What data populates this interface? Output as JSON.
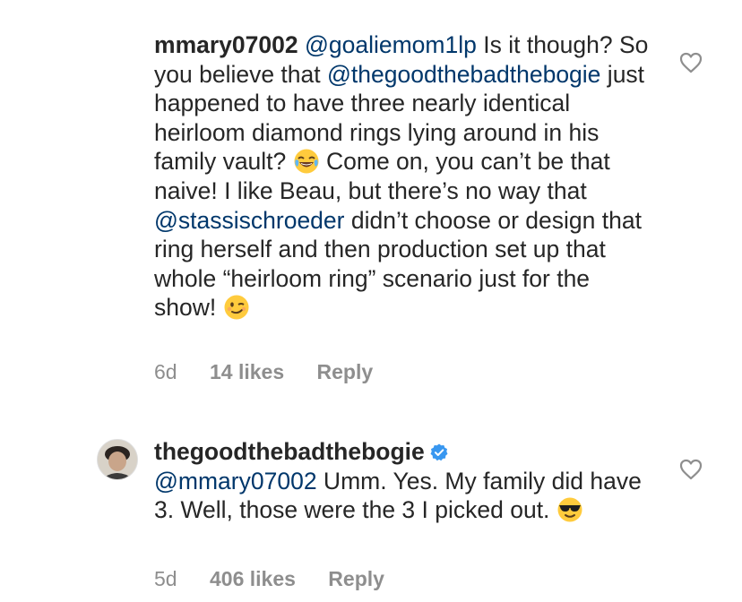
{
  "comments": [
    {
      "username": "mmary07002",
      "mention": "@goaliemom1lp",
      "text_1": " Is it though? So you believe that ",
      "mention_2": "@thegoodthebadthebogie",
      "text_2": " just happened to have three nearly identical heirloom diamond rings lying around in his family vault? ",
      "emoji_1": "face-with-tears-of-joy",
      "text_3": " Come on, you can’t be that naive! I like Beau, but there’s no way that ",
      "mention_3": "@stassischroeder",
      "text_4": " didn’t choose or design that ring herself and then production set up that whole “heirloom ring” scenario just for the show! ",
      "emoji_2": "winking-face",
      "time": "6d",
      "likes": "14 likes",
      "reply": "Reply",
      "liked": false
    },
    {
      "username": "thegoodthebadthebogie",
      "verified": true,
      "mention": "@mmary07002",
      "text_1": " Umm. Yes. My family did have 3. Well, those were the 3 I picked out. ",
      "emoji_1": "smiling-face-with-sunglasses",
      "time": "5d",
      "likes": "406 likes",
      "reply": "Reply",
      "liked": false
    }
  ],
  "colors": {
    "text": "#262626",
    "mention": "#00376b",
    "meta": "#8e8e8e",
    "verified": "#3897f0"
  }
}
